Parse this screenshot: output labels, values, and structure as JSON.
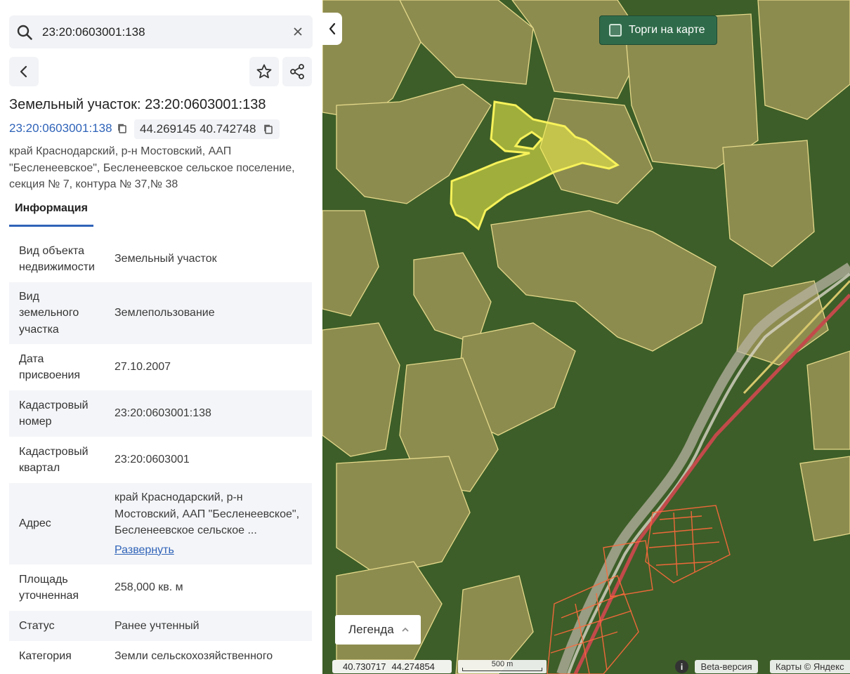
{
  "search": {
    "value": "23:20:0603001:138"
  },
  "title": "Земельный участок: 23:20:0603001:138",
  "cadastral_link": "23:20:0603001:138",
  "coordinates": "44.269145 40.742748",
  "address": "край Краснодарский, р-н Мостовский, ААП \"Бесленеевское\", Бесленеевское сельское поселение, секция № 7, контура № 37,№ 38",
  "tabs": [
    {
      "label": "Информация"
    }
  ],
  "info_rows": [
    {
      "key": "Вид объекта недвижимости",
      "value": "Земельный участок"
    },
    {
      "key": "Вид земельного участка",
      "value": "Землепользование"
    },
    {
      "key": "Дата присвоения",
      "value": "27.10.2007"
    },
    {
      "key": "Кадастровый номер",
      "value": "23:20:0603001:138"
    },
    {
      "key": "Кадастровый квартал",
      "value": "23:20:0603001"
    },
    {
      "key": "Адрес",
      "value": "край Краснодарский, р-н Мостовский, ААП \"Бесленеевское\", Бесленеевское сельское ...",
      "expand": "Развернуть"
    },
    {
      "key": "Площадь уточненная",
      "value": "258,000 кв. м"
    },
    {
      "key": "Статус",
      "value": "Ранее учтенный"
    },
    {
      "key": "Категория",
      "value": "Земли сельскохозяйственного"
    }
  ],
  "map": {
    "torgi_label": "Торги на карте",
    "legend_label": "Легенда",
    "cursor_lon": "40.730717",
    "cursor_lat": "44.274854",
    "scale_label": "500 m",
    "beta_label": "Beta-версия",
    "copyright": "Карты © Яндекс",
    "info_glyph": "i"
  },
  "colors": {
    "accent": "#2f63b8",
    "selected_parcel": "#f2f04a",
    "parcel_border": "#e8e07a",
    "torgi_bg": "#2f6b4a"
  }
}
